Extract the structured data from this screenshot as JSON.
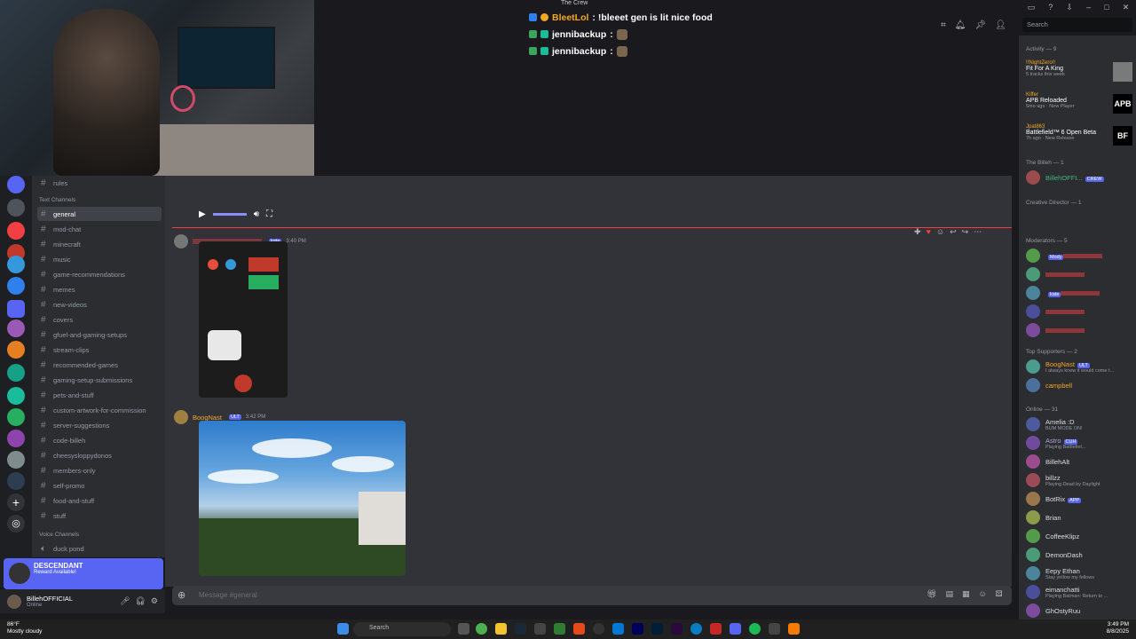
{
  "overlay_chat": {
    "crew_label": "The Crew",
    "lines": [
      {
        "name": "BleetLol",
        "text": ": !bleeet gen is lit nice food"
      },
      {
        "name": "jennibackup",
        "text": ":"
      },
      {
        "name": "jennibackup",
        "text": ":"
      }
    ]
  },
  "topbar": {
    "search_placeholder": "Search"
  },
  "channels": {
    "top_channel": "rules",
    "text_category": "Text Channels",
    "voice_category": "Voice Channels",
    "items": [
      "general",
      "mod-chat",
      "minecraft",
      "music",
      "game-recommendations",
      "memes",
      "new-videos",
      "covers",
      "gfuel-and-gaming-setups",
      "stream-clips",
      "recommended-games",
      "gaming-setup-submissions",
      "pets-and-stuff",
      "custom-artwork-for-commission",
      "server-suggestions",
      "code-billeh",
      "cheesysloppydonos",
      "members-only",
      "self-promo",
      "food-and-stuff",
      "stuff"
    ],
    "voice_items": [
      "duck pond"
    ]
  },
  "promo": {
    "title": "DESCENDANT",
    "subtitle": "Reward Available!"
  },
  "user": {
    "name": "BillehOFFICIAL",
    "status": "Online"
  },
  "messages": {
    "first": {
      "badge": "kate",
      "time": "3:40 PM"
    },
    "second": {
      "author": "BoogNast",
      "badge": "ULT",
      "time": "3:42 PM"
    }
  },
  "input_placeholder": "Message #general",
  "members": {
    "activity_header": "Activity — 9",
    "activities": [
      {
        "user": "!!NightZero!!",
        "title": "Fit For A King",
        "sub": "5 tracks this week"
      },
      {
        "user": "Kiffer",
        "title": "APB Reloaded",
        "sub": "5mo ago · New Player",
        "thumb": "APB"
      },
      {
        "user": "Jpat863",
        "title": "Battlefield™ 6 Open Beta",
        "sub": "7h ago · New Release",
        "thumb": "BF"
      }
    ],
    "sections": [
      {
        "header": "The Billeh — 1",
        "rows": [
          {
            "name": "BillehOFFI...",
            "tag": "CREW",
            "color": "#43b581"
          }
        ]
      },
      {
        "header": "Creative Director — 1",
        "rows": []
      },
      {
        "header": "Moderators — 5",
        "rows": [
          {
            "name": "",
            "tag": "Mody",
            "color": "#f23f43"
          },
          {
            "name": "",
            "tag": "",
            "color": "#f23f43"
          },
          {
            "name": "",
            "tag": "kate",
            "color": "#f23f43"
          },
          {
            "name": "",
            "tag": "",
            "color": "#f23f43"
          },
          {
            "name": "",
            "tag": "",
            "color": "#f23f43"
          }
        ]
      },
      {
        "header": "Top Supporters — 2",
        "rows": [
          {
            "name": "BoogNast",
            "tag": "ULT",
            "sub": "I always knew it would come t...",
            "color": "#f5a623"
          },
          {
            "name": "campbell",
            "tag": "",
            "color": "#f5a623"
          }
        ]
      },
      {
        "header": "Online — 31",
        "rows": [
          {
            "name": "Amelia :D",
            "tag": "",
            "sub": "BUM MODE ON!",
            "color": "#dbdee1"
          },
          {
            "name": "Astro",
            "tag": "CUH",
            "sub": "Playing Battlefiel...",
            "color": "#b5a0e0"
          },
          {
            "name": "BillehAlt",
            "tag": "",
            "color": "#dbdee1"
          },
          {
            "name": "billzz",
            "tag": "",
            "sub": "Playing Dead by Daylight",
            "color": "#dbdee1"
          },
          {
            "name": "BotRix",
            "tag": "APP",
            "color": "#dbdee1"
          },
          {
            "name": "Brian",
            "tag": "",
            "color": "#dbdee1"
          },
          {
            "name": "CoffeeKlipz",
            "tag": "",
            "color": "#dbdee1"
          },
          {
            "name": "DemonDash",
            "tag": "",
            "color": "#dbdee1"
          },
          {
            "name": "Eepy Ethan",
            "tag": "",
            "sub": "Stay yellow my fellows",
            "color": "#dbdee1"
          },
          {
            "name": "eimanchatti",
            "tag": "",
            "sub": "Playing Batman: Return to ...",
            "color": "#dbdee1"
          },
          {
            "name": "GhOstyRuu",
            "tag": "",
            "color": "#dbdee1"
          }
        ]
      }
    ]
  },
  "taskbar": {
    "temp": "86°F",
    "weather": "Mostly cloudy",
    "search": "Search",
    "time": "3:49 PM",
    "date": "8/8/2025"
  }
}
